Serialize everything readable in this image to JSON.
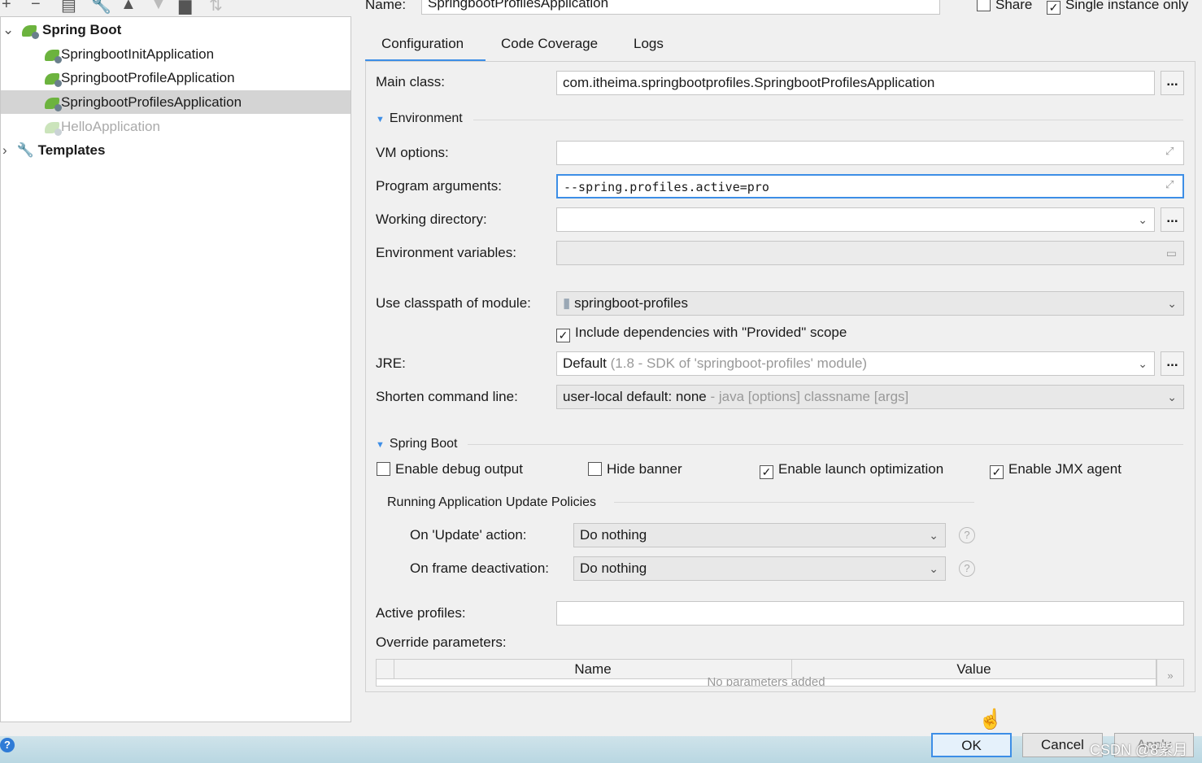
{
  "toolbar": {
    "icons": [
      "plus-icon",
      "minus-icon",
      "copy-icon",
      "wrench-icon",
      "arrow-up-icon",
      "arrow-down-icon",
      "folder-add-icon",
      "sort-icon"
    ]
  },
  "tree": {
    "group": "Spring Boot",
    "items": [
      "SpringbootInitApplication",
      "SpringbootProfileApplication",
      "SpringbootProfilesApplication",
      "HelloApplication"
    ],
    "templates": "Templates"
  },
  "header": {
    "name_label": "Name:",
    "name_value": "SpringbootProfilesApplication",
    "share": "Share",
    "single_instance": "Single instance only"
  },
  "tabs": [
    "Configuration",
    "Code Coverage",
    "Logs"
  ],
  "form": {
    "main_class_label": "Main class:",
    "main_class": "com.itheima.springbootprofiles.SpringbootProfilesApplication",
    "environment": "Environment",
    "vm_label": "VM options:",
    "vm_value": "",
    "args_label": "Program arguments:",
    "args_value": "--spring.profiles.active=pro",
    "wd_label": "Working directory:",
    "wd_value": "",
    "env_label": "Environment variables:",
    "env_value": "",
    "classpath_label": "Use classpath of module:",
    "classpath_value": "springboot-profiles",
    "include_deps": "Include dependencies with \"Provided\" scope",
    "jre_label": "JRE:",
    "jre_value": "Default",
    "jre_hint": "(1.8 - SDK of 'springboot-profiles' module)",
    "shorten_label": "Shorten command line:",
    "shorten_value": "user-local default: none",
    "shorten_hint": "- java [options] classname [args]"
  },
  "spring_boot": {
    "title": "Spring Boot",
    "debug": "Enable debug output",
    "hide_banner": "Hide banner",
    "launch_opt": "Enable launch optimization",
    "jmx": "Enable JMX agent",
    "policies": "Running Application Update Policies",
    "update_label": "On 'Update' action:",
    "update_value": "Do nothing",
    "frame_label": "On frame deactivation:",
    "frame_value": "Do nothing",
    "active_profiles_label": "Active profiles:",
    "active_profiles_value": "",
    "override_label": "Override parameters:",
    "columns": [
      "Name",
      "Value"
    ],
    "empty": "No parameters added"
  },
  "buttons": {
    "ok": "OK",
    "cancel": "Cancel",
    "apply": "Apply"
  },
  "watermark": "CSDN @8紫月"
}
